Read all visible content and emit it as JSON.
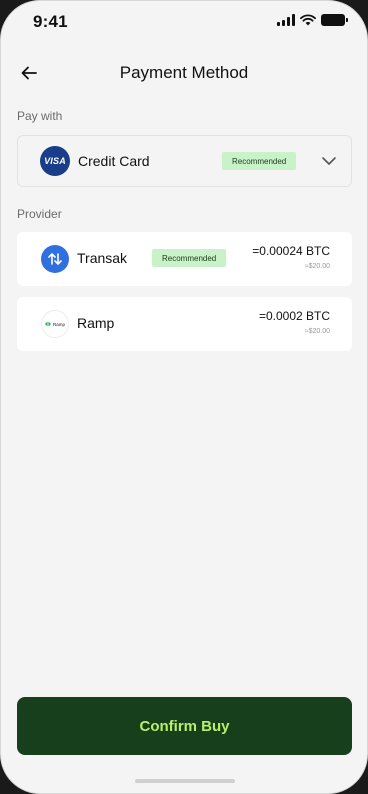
{
  "status_bar": {
    "time": "9:41"
  },
  "header": {
    "title": "Payment Method"
  },
  "pay_with": {
    "label": "Pay with",
    "method": {
      "name": "Credit Card",
      "logo_text": "VISA",
      "badge": "Recommended"
    }
  },
  "provider_section": {
    "label": "Provider",
    "providers": [
      {
        "name": "Transak",
        "badge": "Recommended",
        "amount": "=0.00024 BTC",
        "fiat": "≈$20.00"
      },
      {
        "name": "Ramp",
        "logo_text": "Ramp",
        "amount": "=0.0002 BTC",
        "fiat": "≈$20.00"
      }
    ]
  },
  "confirm": {
    "label": "Confirm Buy"
  },
  "colors": {
    "accent_dark": "#183f1c",
    "accent_text": "#b6f06a",
    "badge_bg": "#c9f2c9",
    "transak_blue": "#2f6fe0",
    "visa_blue": "#1a3d8a"
  }
}
